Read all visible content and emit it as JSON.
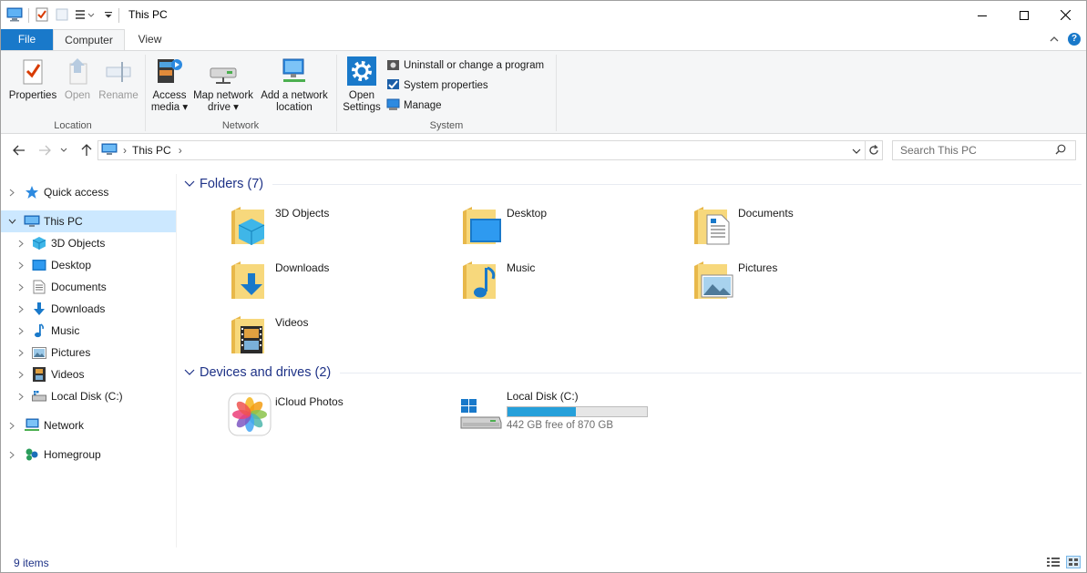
{
  "window": {
    "title": "This PC"
  },
  "ribbon": {
    "tabs": {
      "file": "File",
      "computer": "Computer",
      "view": "View"
    },
    "location": {
      "label": "Location",
      "properties": "Properties",
      "open": "Open",
      "rename": "Rename"
    },
    "network": {
      "label": "Network",
      "access_media": [
        "Access",
        "media"
      ],
      "map_drive": [
        "Map network",
        "drive"
      ],
      "add_location": [
        "Add a network",
        "location"
      ]
    },
    "system": {
      "label": "System",
      "open_settings": [
        "Open",
        "Settings"
      ],
      "uninstall": "Uninstall or change a program",
      "system_properties": "System properties",
      "manage": "Manage"
    }
  },
  "address": {
    "path": "This PC",
    "search_placeholder": "Search This PC"
  },
  "nav": {
    "quick_access": "Quick access",
    "this_pc": "This PC",
    "children": [
      "3D Objects",
      "Desktop",
      "Documents",
      "Downloads",
      "Music",
      "Pictures",
      "Videos",
      "Local Disk (C:)"
    ],
    "network": "Network",
    "homegroup": "Homegroup"
  },
  "content": {
    "folders_header": "Folders (7)",
    "folders": [
      "3D Objects",
      "Desktop",
      "Documents",
      "Downloads",
      "Music",
      "Pictures",
      "Videos"
    ],
    "devices_header": "Devices and drives (2)",
    "devices": {
      "icloud": "iCloud Photos",
      "disk_name": "Local Disk (C:)",
      "disk_free": "442 GB free of 870 GB",
      "disk_used_fraction": 0.492
    }
  },
  "status": {
    "items": "9 items"
  },
  "colors": {
    "accent": "#1979ca",
    "selection": "#cce8ff",
    "header_text": "#1e3287",
    "folder": "#f2c55c",
    "drive_fill": "#26a0da"
  }
}
